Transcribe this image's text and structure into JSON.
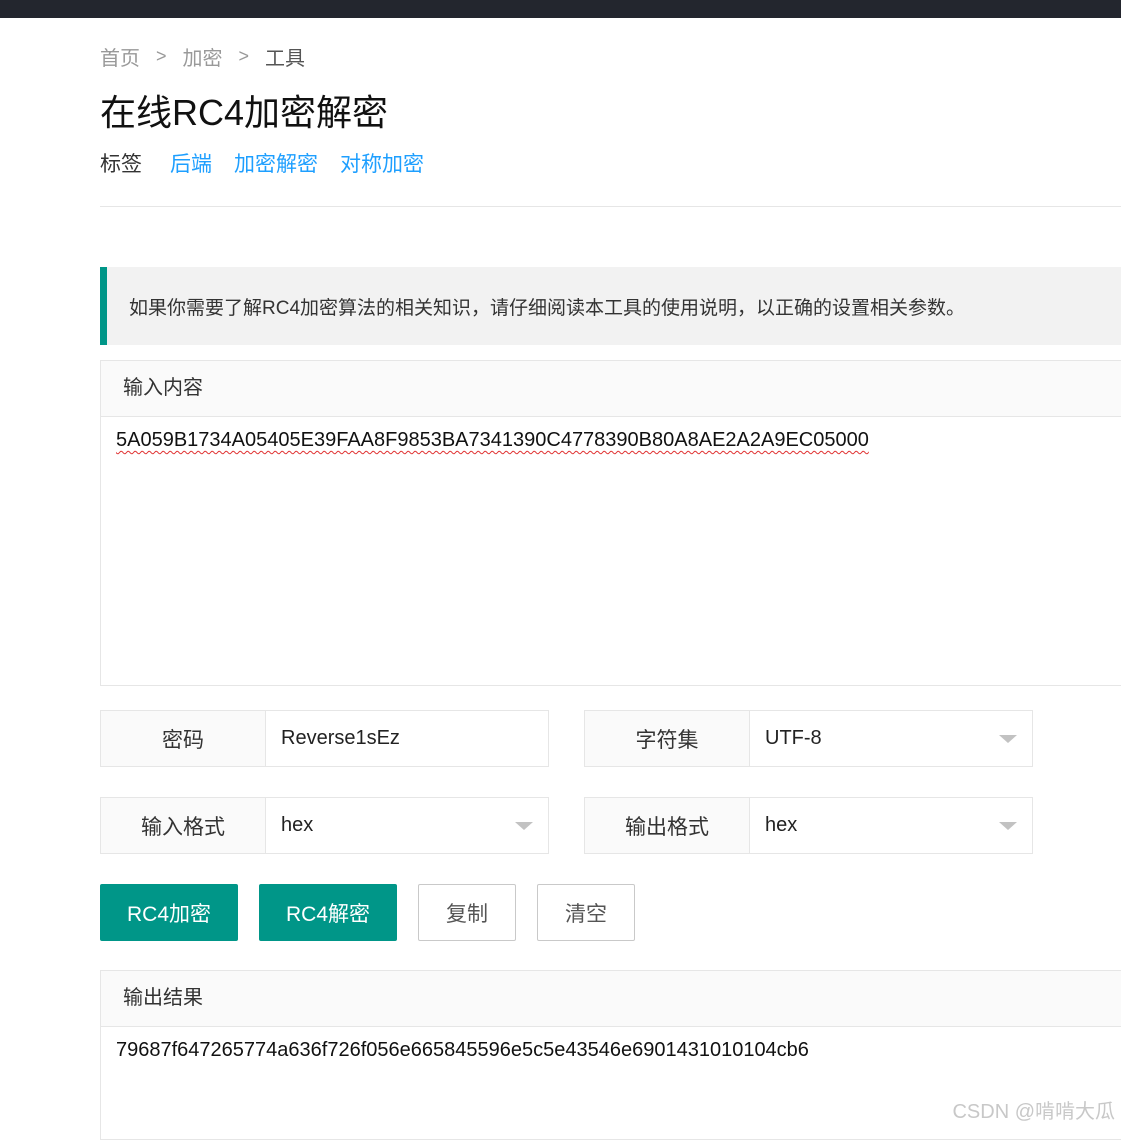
{
  "breadcrumb": {
    "home": "首页",
    "sep": ">",
    "category": "加密",
    "current": "工具"
  },
  "page_title": "在线RC4加密解密",
  "tags": {
    "label": "标签",
    "items": [
      "后端",
      "加密解密",
      "对称加密"
    ]
  },
  "notice": "如果你需要了解RC4加密算法的相关知识，请仔细阅读本工具的使用说明，以正确的设置相关参数。",
  "input": {
    "header": "输入内容",
    "value": "5A059B1734A05405E39FAA8F9853BA7341390C4778390B80A8AE2A2A9EC05000"
  },
  "fields": {
    "key": {
      "label": "密码",
      "value": "Reverse1sEz"
    },
    "charset": {
      "label": "字符集",
      "value": "UTF-8"
    },
    "input_format": {
      "label": "输入格式",
      "value": "hex"
    },
    "output_format": {
      "label": "输出格式",
      "value": "hex"
    }
  },
  "buttons": {
    "encrypt": "RC4加密",
    "decrypt": "RC4解密",
    "copy": "复制",
    "clear": "清空"
  },
  "output": {
    "header": "输出结果",
    "value": "79687f647265774a636f726f056e665845596e5c5e43546e6901431010104cb6"
  },
  "watermark": "CSDN @啃啃大瓜",
  "colors": {
    "accent": "#009688",
    "link": "#1e9fff",
    "topbar": "#23262e"
  }
}
